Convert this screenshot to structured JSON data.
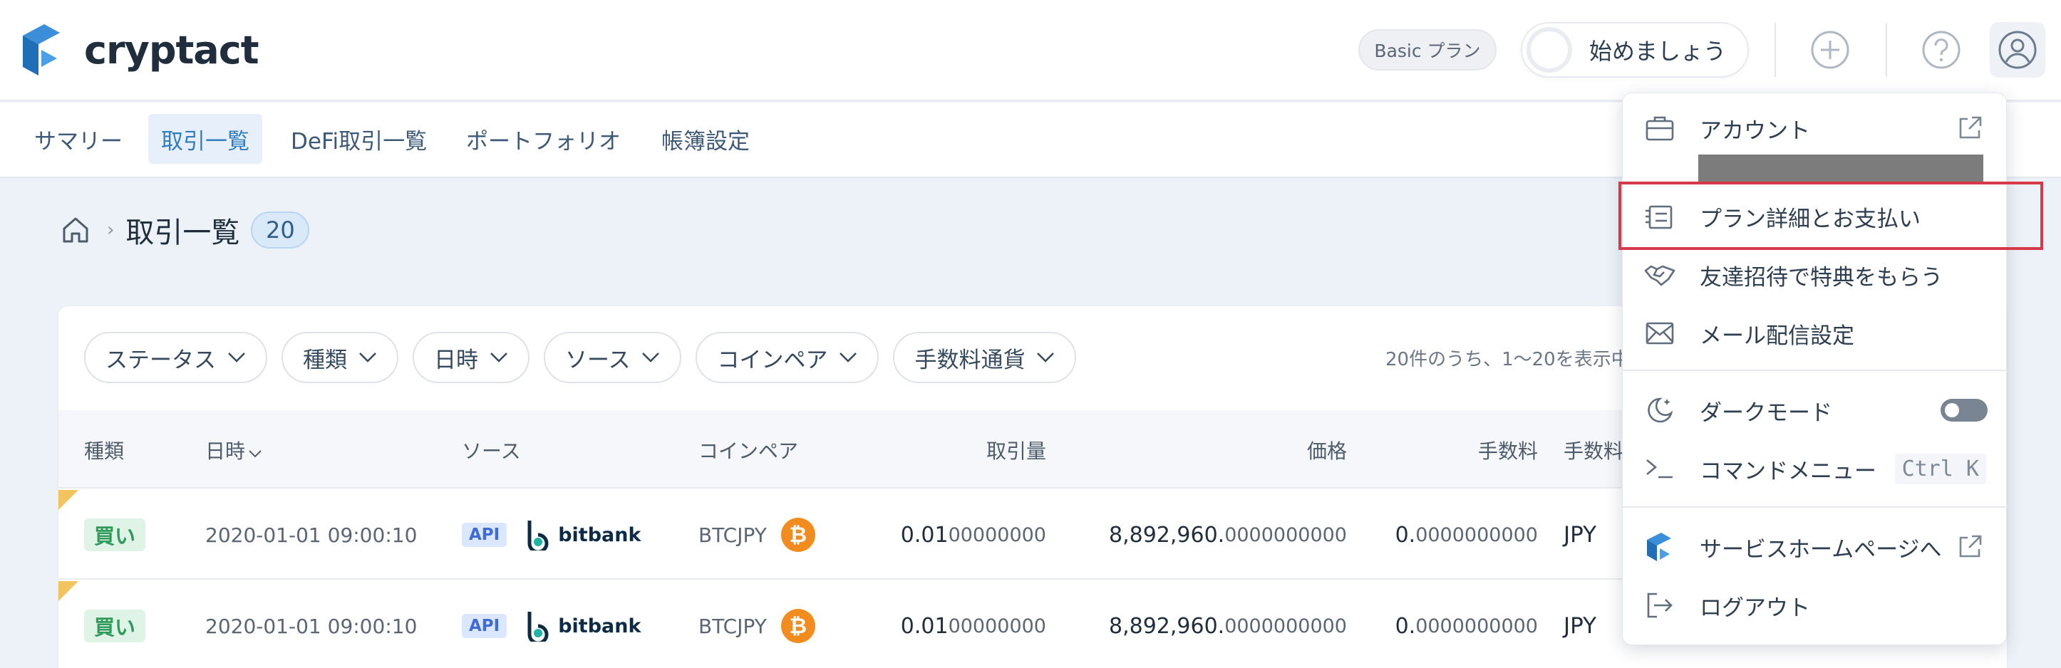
{
  "app": {
    "brand": "cryptact",
    "plan_badge": "Basic プラン",
    "start_label": "始めましょう",
    "brand_color": "#2f7cc0"
  },
  "nav": {
    "tabs": [
      {
        "label": "サマリー",
        "active": false
      },
      {
        "label": "取引一覧",
        "active": true
      },
      {
        "label": "DeFi取引一覧",
        "active": false
      },
      {
        "label": "ポートフォリオ",
        "active": false
      },
      {
        "label": "帳簿設定",
        "active": false
      }
    ]
  },
  "breadcrumb": {
    "title": "取引一覧",
    "count": "20"
  },
  "filters": {
    "items": [
      "ステータス",
      "種類",
      "日時",
      "ソース",
      "コインペア",
      "手数料通貨"
    ],
    "count_text": "20件のうち、1〜20を表示中"
  },
  "table": {
    "headers": {
      "type": "種類",
      "datetime": "日時",
      "source": "ソース",
      "pair": "コインペア",
      "volume": "取引量",
      "price": "価格",
      "fee": "手数料",
      "fee_currency": "手数料"
    },
    "rows": [
      {
        "type": "買い",
        "datetime": "2020-01-01 09:00:10",
        "source_badge": "API",
        "exchange": "bitbank",
        "pair": "BTCJPY",
        "coin_symbol": "₿",
        "volume_main": "0.01",
        "volume_dec": "00000000",
        "price_main": "8,892,960.",
        "price_dec": "0000000000",
        "fee_main": "0.",
        "fee_dec": "0000000000",
        "fee_currency": "JPY"
      },
      {
        "type": "買い",
        "datetime": "2020-01-01 09:00:10",
        "source_badge": "API",
        "exchange": "bitbank",
        "pair": "BTCJPY",
        "coin_symbol": "₿",
        "volume_main": "0.01",
        "volume_dec": "00000000",
        "price_main": "8,892,960.",
        "price_dec": "0000000000",
        "fee_main": "0.",
        "fee_dec": "0000000000",
        "fee_currency": "JPY"
      }
    ]
  },
  "menu": {
    "account": "アカウント",
    "plan_details": "プラン詳細とお支払い",
    "referral": "友達招待で特典をもらう",
    "mail_settings": "メール配信設定",
    "dark_mode": "ダークモード",
    "dark_mode_on": false,
    "command_menu": "コマンドメニュー",
    "command_shortcut": "Ctrl K",
    "service_home": "サービスホームページへ",
    "logout": "ログアウト",
    "highlight_color": "#d63a4a"
  }
}
